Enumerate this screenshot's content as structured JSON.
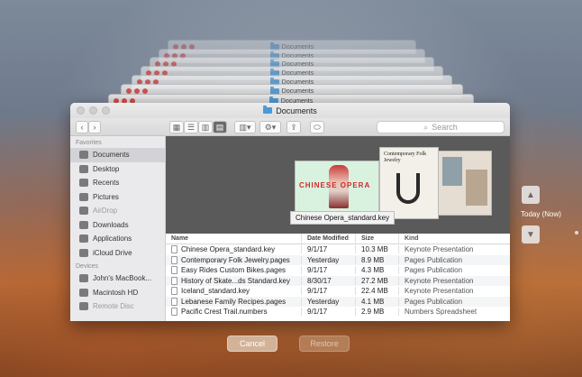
{
  "window": {
    "title": "Documents",
    "search_placeholder": "Search"
  },
  "stack_title": "Documents",
  "sidebar": {
    "favorites_heading": "Favorites",
    "favorites": [
      {
        "label": "Documents",
        "icon": "documents-icon",
        "selected": true
      },
      {
        "label": "Desktop",
        "icon": "desktop-icon"
      },
      {
        "label": "Recents",
        "icon": "clock-icon"
      },
      {
        "label": "Pictures",
        "icon": "camera-icon"
      },
      {
        "label": "AirDrop",
        "icon": "airdrop-icon",
        "dim": true
      },
      {
        "label": "Downloads",
        "icon": "download-icon"
      },
      {
        "label": "Applications",
        "icon": "applications-icon"
      },
      {
        "label": "iCloud Drive",
        "icon": "cloud-icon"
      }
    ],
    "devices_heading": "Devices",
    "devices": [
      {
        "label": "John's MacBook...",
        "icon": "laptop-icon"
      },
      {
        "label": "Macintosh HD",
        "icon": "disk-icon"
      },
      {
        "label": "Remote Disc",
        "icon": "disc-icon",
        "dim": true
      }
    ]
  },
  "preview": {
    "selected_file": "Chinese Opera_standard.key",
    "card1_text": "CHINESE OPERA",
    "card2_title": "Contemporary Folk Jewelry"
  },
  "file_list": {
    "headers": {
      "name": "Name",
      "date": "Date Modified",
      "size": "Size",
      "kind": "Kind"
    },
    "rows": [
      {
        "name": "Chinese Opera_standard.key",
        "date": "9/1/17",
        "size": "10.3 MB",
        "kind": "Keynote Presentation"
      },
      {
        "name": "Contemporary Folk Jewelry.pages",
        "date": "Yesterday",
        "size": "8.9 MB",
        "kind": "Pages Publication"
      },
      {
        "name": "Easy Rides Custom Bikes.pages",
        "date": "9/1/17",
        "size": "4.3 MB",
        "kind": "Pages Publication"
      },
      {
        "name": "History of Skate...ds Standard.key",
        "date": "8/30/17",
        "size": "27.2 MB",
        "kind": "Keynote Presentation"
      },
      {
        "name": "Iceland_standard.key",
        "date": "9/1/17",
        "size": "22.4 MB",
        "kind": "Keynote Presentation"
      },
      {
        "name": "Lebanese Family Recipes.pages",
        "date": "Yesterday",
        "size": "4.1 MB",
        "kind": "Pages Publication"
      },
      {
        "name": "Pacific Crest Trail.numbers",
        "date": "9/1/17",
        "size": "2.9 MB",
        "kind": "Numbers Spreadsheet"
      }
    ]
  },
  "timeline": {
    "label": "Today (Now)"
  },
  "buttons": {
    "cancel": "Cancel",
    "restore": "Restore"
  },
  "colors": {
    "folder": "#4a9ad8",
    "close": "#e0443e"
  }
}
